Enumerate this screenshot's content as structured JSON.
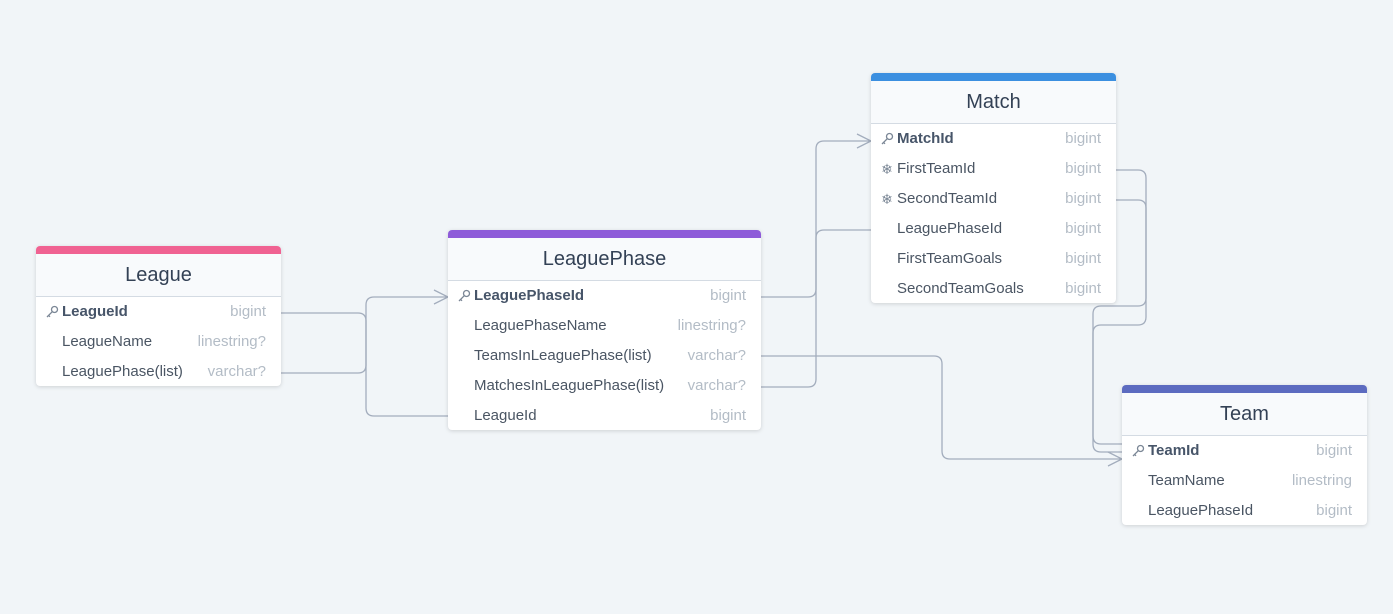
{
  "colors": {
    "background": "#f1f5f8",
    "connector": "#a3adbd",
    "league": "#f06292",
    "league_phase": "#8e5bd9",
    "match": "#3b8fe0",
    "team": "#5c6bc0"
  },
  "tables": {
    "league": {
      "title": "League",
      "fields": [
        {
          "name": "LeagueId",
          "type": "bigint",
          "icon": "key-icon"
        },
        {
          "name": "LeagueName",
          "type": "linestring?",
          "icon": ""
        },
        {
          "name": "LeaguePhase(list)",
          "type": "varchar?",
          "icon": ""
        }
      ]
    },
    "league_phase": {
      "title": "LeaguePhase",
      "fields": [
        {
          "name": "LeaguePhaseId",
          "type": "bigint",
          "icon": "key-icon"
        },
        {
          "name": "LeaguePhaseName",
          "type": "linestring?",
          "icon": ""
        },
        {
          "name": "TeamsInLeaguePhase(list)",
          "type": "varchar?",
          "icon": ""
        },
        {
          "name": "MatchesInLeaguePhase(list)",
          "type": "varchar?",
          "icon": ""
        },
        {
          "name": "LeagueId",
          "type": "bigint",
          "icon": ""
        }
      ]
    },
    "match": {
      "title": "Match",
      "fields": [
        {
          "name": "MatchId",
          "type": "bigint",
          "icon": "key-icon"
        },
        {
          "name": "FirstTeamId",
          "type": "bigint",
          "icon": "snowflake-icon"
        },
        {
          "name": "SecondTeamId",
          "type": "bigint",
          "icon": "snowflake-icon"
        },
        {
          "name": "LeaguePhaseId",
          "type": "bigint",
          "icon": ""
        },
        {
          "name": "FirstTeamGoals",
          "type": "bigint",
          "icon": ""
        },
        {
          "name": "SecondTeamGoals",
          "type": "bigint",
          "icon": ""
        }
      ]
    },
    "team": {
      "title": "Team",
      "fields": [
        {
          "name": "TeamId",
          "type": "bigint",
          "icon": "key-icon"
        },
        {
          "name": "TeamName",
          "type": "linestring",
          "icon": ""
        },
        {
          "name": "LeaguePhaseId",
          "type": "bigint",
          "icon": ""
        }
      ]
    }
  }
}
